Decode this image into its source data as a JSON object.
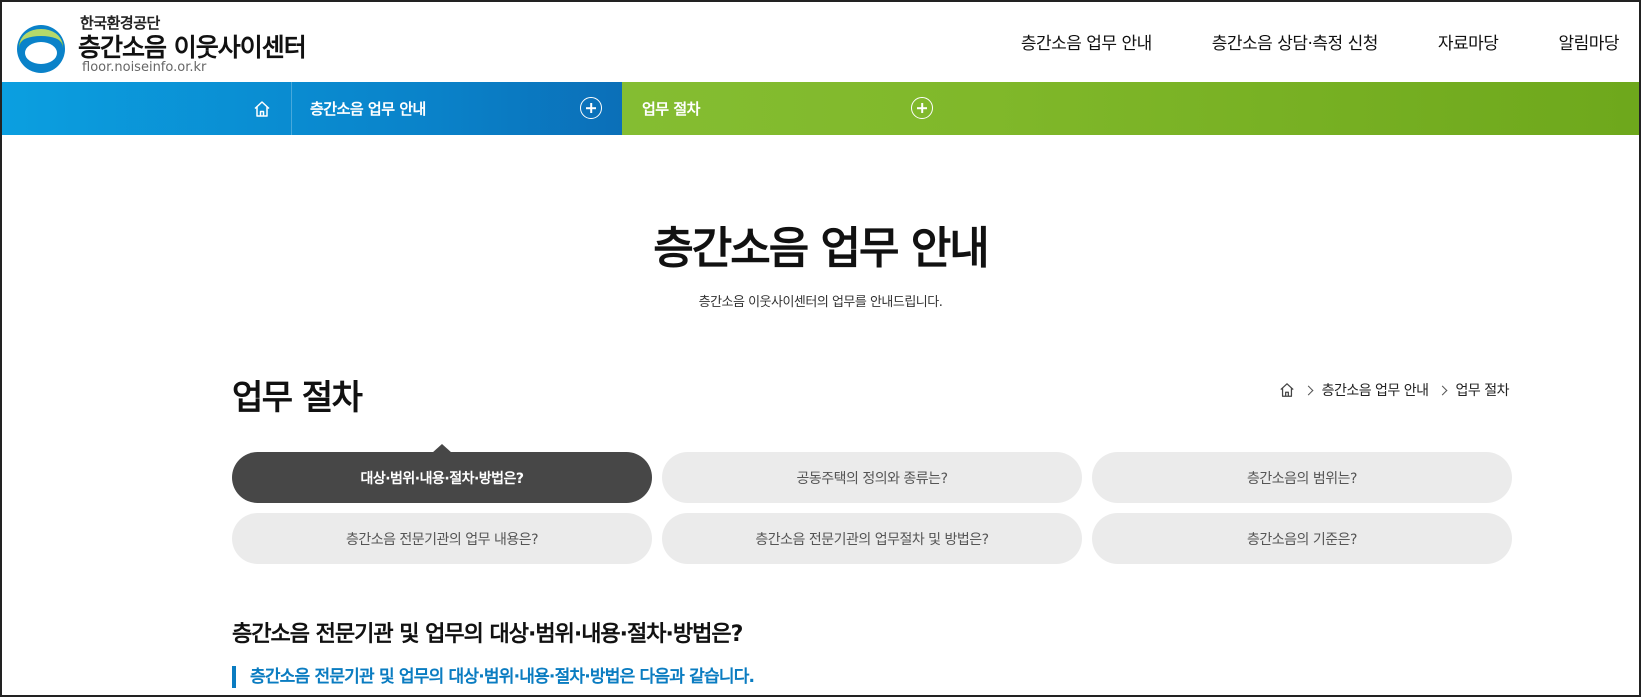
{
  "header": {
    "org": "한국환경공단",
    "site_name": "층간소음 이웃사이센터",
    "site_url": "floor.noiseinfo.or.kr",
    "gnb": [
      {
        "label": "층간소음 업무 안내"
      },
      {
        "label": "층간소음 상담·측정 신청"
      },
      {
        "label": "자료마당"
      },
      {
        "label": "알림마당"
      }
    ]
  },
  "subnav": {
    "home_icon": "home-icon",
    "level1_label": "층간소음 업무 안내",
    "level2_label": "업무 절차",
    "colors": {
      "level1": "#0a82c9",
      "level2": "#8cc63f"
    }
  },
  "page": {
    "title": "층간소음 업무 안내",
    "description": "층간소음 이웃사이센터의 업무를 안내드립니다."
  },
  "section": {
    "title": "업무 절차",
    "breadcrumb": [
      "층간소음 업무 안내",
      "업무 절차"
    ]
  },
  "tabs": [
    {
      "label": "대상·범위·내용·절차·방법은?",
      "active": true
    },
    {
      "label": "공동주택의 정의와 종류는?",
      "active": false
    },
    {
      "label": "층간소음의 범위는?",
      "active": false
    },
    {
      "label": "층간소음 전문기관의 업무 내용은?",
      "active": false
    },
    {
      "label": "층간소음 전문기관의 업무절차 및 방법은?",
      "active": false
    },
    {
      "label": "층간소음의 기준은?",
      "active": false
    }
  ],
  "content": {
    "heading": "층간소음 전문기관 및 업무의 대상·범위·내용·절차·방법은?",
    "subheading": "층간소음 전문기관 및 업무의 대상·범위·내용·절차·방법은 다음과 같습니다.",
    "accent_color": "#0a7cc1"
  }
}
